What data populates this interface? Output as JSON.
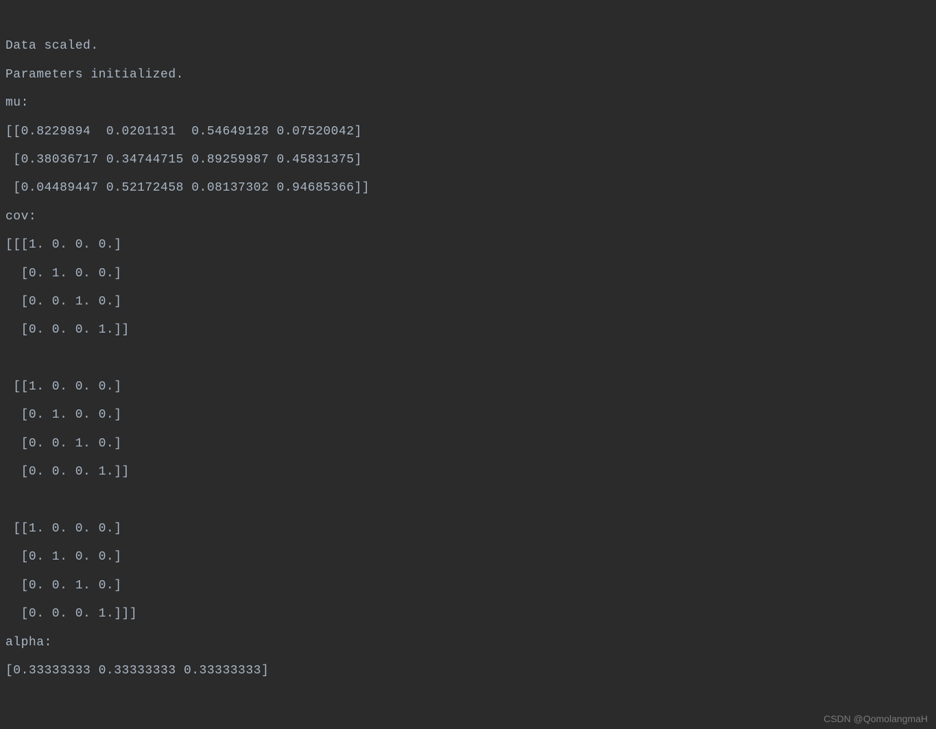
{
  "console": {
    "lines": [
      "Data scaled.",
      "Parameters initialized.",
      "mu:",
      "[[0.8229894  0.0201131  0.54649128 0.07520042]",
      " [0.38036717 0.34744715 0.89259987 0.45831375]",
      " [0.04489447 0.52172458 0.08137302 0.94685366]]",
      "cov:",
      "[[[1. 0. 0. 0.]",
      "  [0. 1. 0. 0.]",
      "  [0. 0. 1. 0.]",
      "  [0. 0. 0. 1.]]",
      "",
      " [[1. 0. 0. 0.]",
      "  [0. 1. 0. 0.]",
      "  [0. 0. 1. 0.]",
      "  [0. 0. 0. 1.]]",
      "",
      " [[1. 0. 0. 0.]",
      "  [0. 1. 0. 0.]",
      "  [0. 0. 1. 0.]",
      "  [0. 0. 0. 1.]]]",
      "alpha:",
      "[0.33333333 0.33333333 0.33333333]"
    ]
  },
  "watermark": {
    "text": "CSDN @QomolangmaH"
  }
}
